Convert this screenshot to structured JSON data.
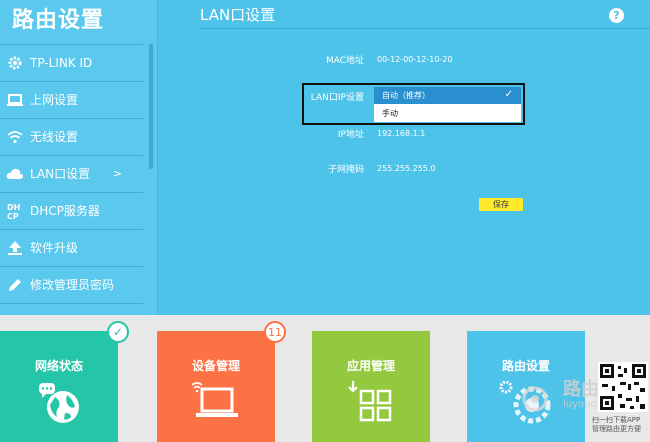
{
  "app": {
    "title": "路由设置"
  },
  "sidebar": {
    "items": [
      {
        "label": "TP-LINK ID",
        "icon": "gear-icon"
      },
      {
        "label": "上网设置",
        "icon": "monitor-icon"
      },
      {
        "label": "无线设置",
        "icon": "wifi-icon"
      },
      {
        "label": "LAN口设置",
        "icon": "cloud-icon",
        "arrow": ">"
      },
      {
        "label": "DHCP服务器",
        "icon": "dhcp-icon",
        "icon_text": "DH\nCP"
      },
      {
        "label": "软件升级",
        "icon": "upload-icon"
      },
      {
        "label": "修改管理员密码",
        "icon": "pencil-icon"
      }
    ]
  },
  "panel": {
    "title": "LAN口设置",
    "help": "?",
    "fields": {
      "mac": {
        "label": "MAC地址",
        "value": "00-12-00-12-10-20"
      },
      "lan_ip_mode": {
        "label": "LAN口IP设置",
        "selected": "自动（推荐）",
        "options": [
          "手动"
        ],
        "check": "✓"
      },
      "ip": {
        "label": "IP地址",
        "value": "192.168.1.1"
      },
      "mask": {
        "label": "子网掩码",
        "value": "255.255.255.0"
      }
    },
    "save_label": "保存"
  },
  "bottom_tiles": [
    {
      "label": "网络状态",
      "color": "#25c5a8"
    },
    {
      "label": "设备管理",
      "color": "#fc7244",
      "badge": "11"
    },
    {
      "label": "应用管理",
      "color": "#94c83f"
    },
    {
      "label": "路由设置",
      "color": "#4ec3ea"
    }
  ],
  "qr": {
    "caption_line1": "扫一扫下载APP",
    "caption_line2": "管理路由更方便"
  },
  "watermark": "路由 luyouqi"
}
